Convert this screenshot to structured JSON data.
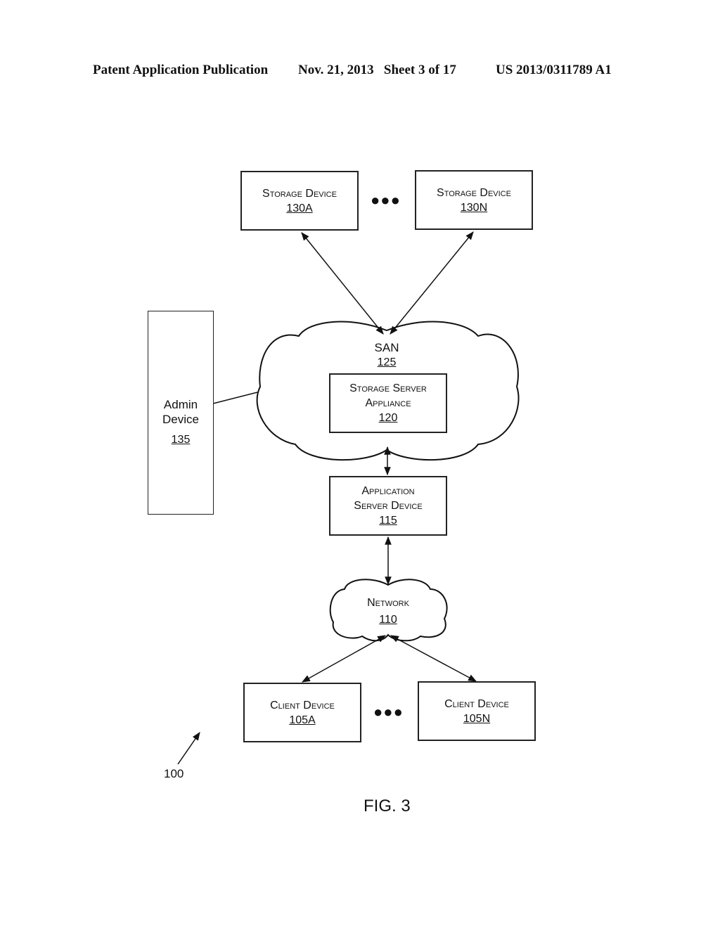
{
  "header": {
    "publication": "Patent Application Publication",
    "date_sheet": "Nov. 21, 2013   Sheet 3 of 17",
    "patent_number": "US 2013/0311789 A1"
  },
  "nodes": {
    "storage_a": {
      "label": "Storage Device",
      "ref": "130A"
    },
    "storage_n": {
      "label": "Storage Device",
      "ref": "130N"
    },
    "san": {
      "label": "SAN",
      "ref": "125"
    },
    "storage_server": {
      "label_line1": "Storage Server",
      "label_line2": "Appliance",
      "ref": "120"
    },
    "admin": {
      "label_line1": "Admin",
      "label_line2": "Device",
      "ref": "135"
    },
    "app_server": {
      "label_line1": "Application",
      "label_line2": "Server Device",
      "ref": "115"
    },
    "network": {
      "label": "Network",
      "ref": "110"
    },
    "client_a": {
      "label": "Client Device",
      "ref": "105A"
    },
    "client_n": {
      "label": "Client Device",
      "ref": "105N"
    }
  },
  "ellipsis": "●●●",
  "system_ref": "100",
  "figure_label": "FIG. 3"
}
